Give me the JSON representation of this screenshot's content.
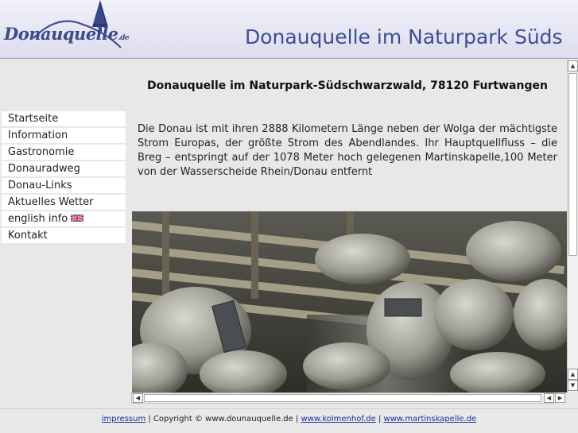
{
  "header": {
    "logo_text": "Donauquelle",
    "logo_suffix": ".de",
    "title": "Donauquelle im Naturpark Süds"
  },
  "content": {
    "title": "Donauquelle im Naturpark-Südschwarzwald, 78120 Furtwangen",
    "intro": "Die Donau ist mit ihren 2888 Kilometern Länge neben der Wolga der mächtigste Strom Europas, der größte Strom des Abendlandes. Ihr Hauptquellfluss – die Breg – entspringt auf der 1078 Meter hoch gelegenen Martinskapelle,100 Meter von der Wasserscheide Rhein/Donau entfernt"
  },
  "nav": {
    "items": [
      {
        "label": "Startseite"
      },
      {
        "label": "Information"
      },
      {
        "label": "Gastronomie"
      },
      {
        "label": "Donauradweg"
      },
      {
        "label": "Donau-Links"
      },
      {
        "label": "Aktuelles Wetter"
      },
      {
        "label": "english info"
      },
      {
        "label": "Kontakt"
      }
    ]
  },
  "footer": {
    "impressum": "impressum",
    "copyright": " | Copyright © www.dounauquelle.de | ",
    "sep": " | ",
    "link1": "www.kolmenhof.de",
    "link2": "www.martinskapelle.de"
  },
  "colors": {
    "header_title": "#3d4e96",
    "link": "#1d2fa0",
    "background": "#e8e8e8"
  }
}
